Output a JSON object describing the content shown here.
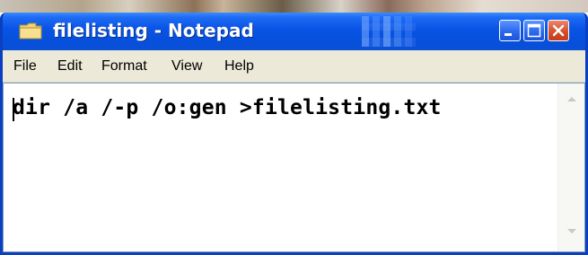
{
  "window": {
    "title": "filelisting - Notepad",
    "accent_color": "#0b55e6",
    "close_color": "#d6502d"
  },
  "icons": {
    "app": "notepad-folder-icon",
    "minimize": "minimize-icon",
    "maximize": "maximize-icon",
    "close": "close-icon",
    "scroll_up": "scroll-up-arrow-icon",
    "scroll_down": "scroll-down-arrow-icon"
  },
  "menu": {
    "items": [
      "File",
      "Edit",
      "Format",
      "View",
      "Help"
    ]
  },
  "editor": {
    "content": "dir /a /-p /o:gen >filelisting.txt"
  }
}
